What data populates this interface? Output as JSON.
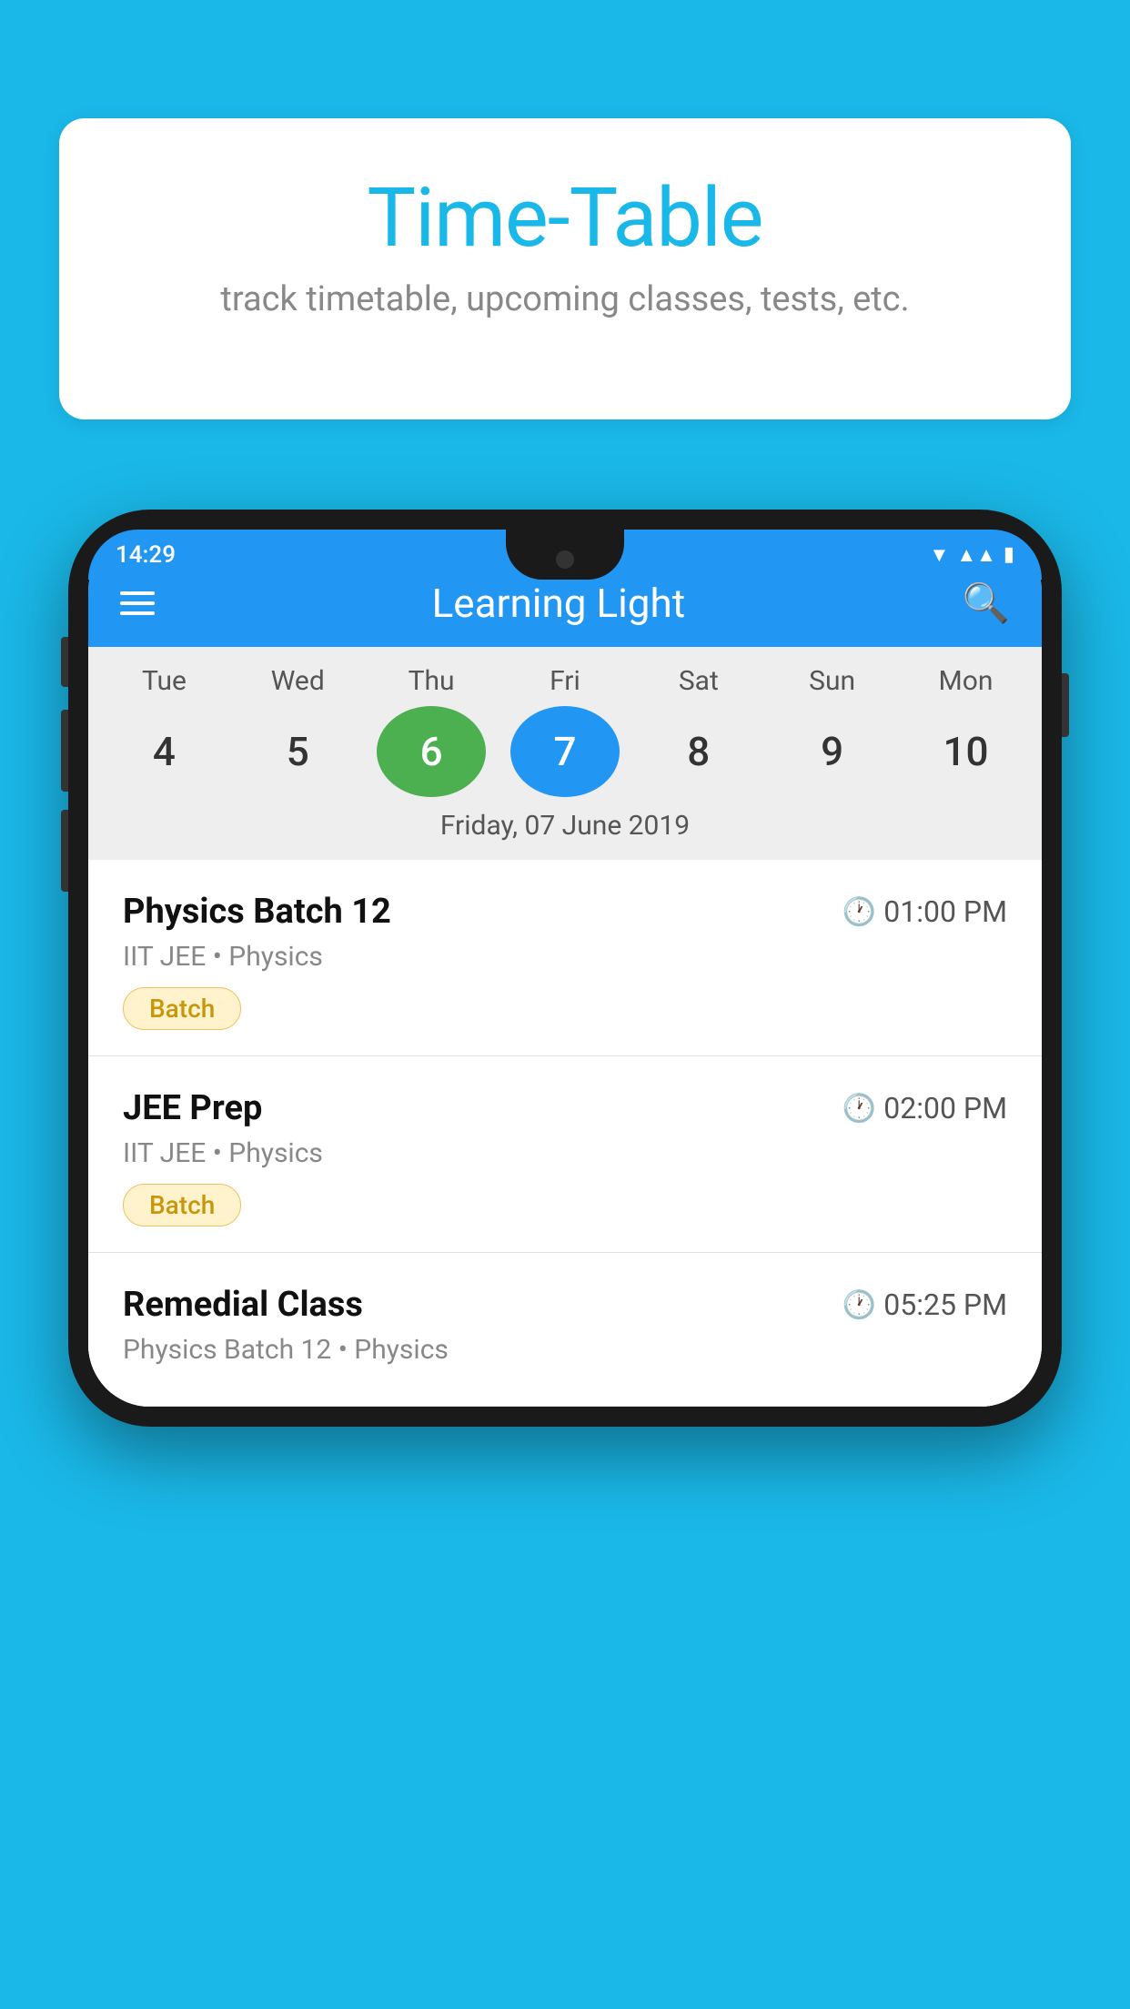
{
  "background_color": "#1ab8e8",
  "speech_bubble": {
    "title": "Time-Table",
    "subtitle": "track timetable, upcoming classes, tests, etc."
  },
  "phone": {
    "status_bar": {
      "time": "14:29"
    },
    "app_header": {
      "title": "Learning Light"
    },
    "calendar": {
      "days": [
        "Tue",
        "Wed",
        "Thu",
        "Fri",
        "Sat",
        "Sun",
        "Mon"
      ],
      "dates": [
        "4",
        "5",
        "6",
        "7",
        "8",
        "9",
        "10"
      ],
      "today_index": 2,
      "selected_index": 3,
      "selected_date_label": "Friday, 07 June 2019"
    },
    "classes": [
      {
        "name": "Physics Batch 12",
        "time": "01:00 PM",
        "meta": "IIT JEE • Physics",
        "badge": "Batch"
      },
      {
        "name": "JEE Prep",
        "time": "02:00 PM",
        "meta": "IIT JEE • Physics",
        "badge": "Batch"
      },
      {
        "name": "Remedial Class",
        "time": "05:25 PM",
        "meta": "Physics Batch 12 • Physics",
        "badge": null
      }
    ]
  }
}
